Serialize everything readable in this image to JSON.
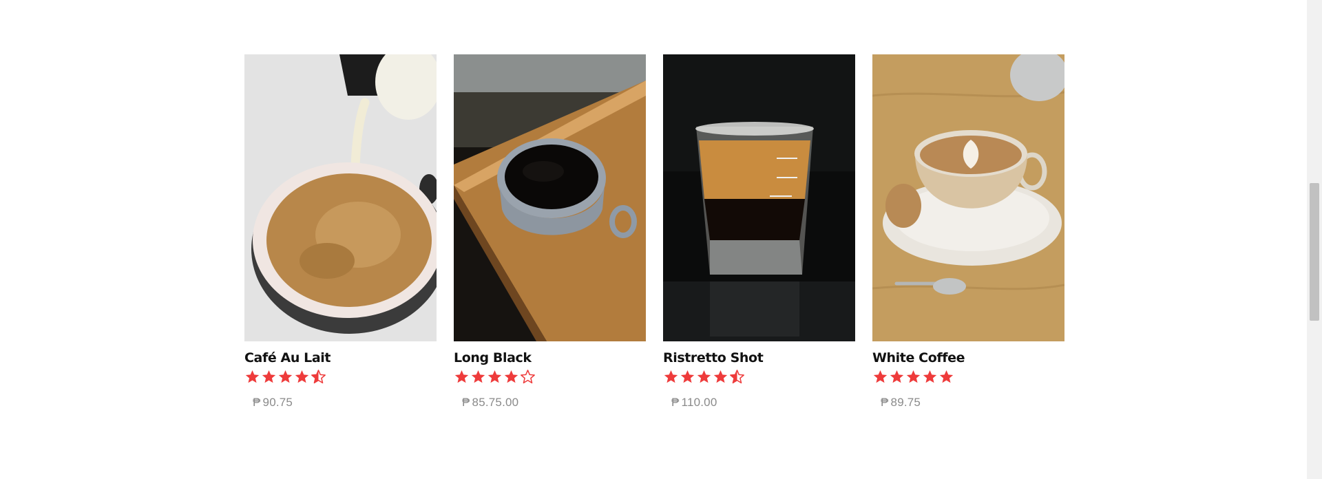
{
  "colors": {
    "star": "#ee3b3b",
    "price": "#8a8a8a",
    "name": "#111111"
  },
  "products": [
    {
      "name": "Café Au Lait",
      "currency": "₱",
      "price": "90.75",
      "rating": 4.5,
      "image": "milk-pour-coffee-photo"
    },
    {
      "name": "Long Black",
      "currency": "₱",
      "price": "85.75.00",
      "rating": 4,
      "image": "black-coffee-cup-photo"
    },
    {
      "name": "Ristretto Shot",
      "currency": "₱",
      "price": "110.00",
      "rating": 4.5,
      "image": "espresso-shot-glass-photo"
    },
    {
      "name": "White Coffee",
      "currency": "₱",
      "price": "89.75",
      "rating": 5,
      "image": "latte-art-cup-photo"
    }
  ]
}
